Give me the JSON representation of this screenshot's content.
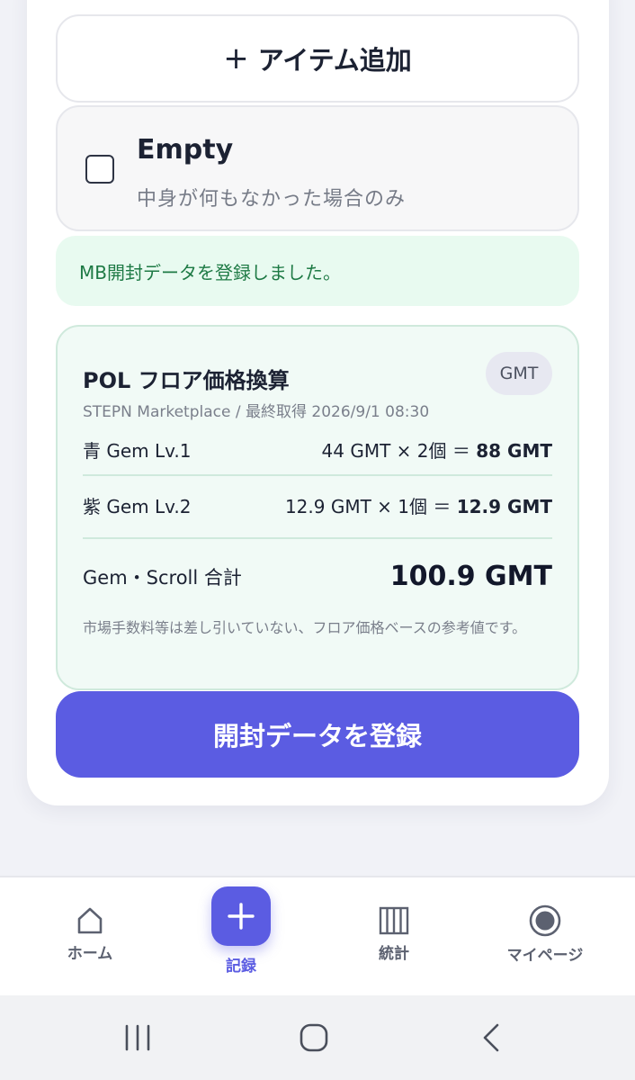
{
  "add_item": {
    "plus": "+",
    "label": "アイテム追加"
  },
  "empty_option": {
    "title": "Empty",
    "subtitle": "中身が何もなかった場合のみ",
    "checked": false
  },
  "toast": {
    "message": "MB開封データを登録しました。"
  },
  "pol_card": {
    "title": "POL フロア価格換算",
    "currency_badge": "GMT",
    "source": "STEPN Marketplace / 最終取得 2026/9/1 08:30",
    "rows": [
      {
        "name": "青 Gem Lv.1",
        "calc": "44 GMT × 2個 ＝",
        "result": "88 GMT"
      },
      {
        "name": "紫 Gem Lv.2",
        "calc": "12.9 GMT × 1個 ＝",
        "result": "12.9 GMT"
      }
    ],
    "total_label": "Gem・Scroll 合計",
    "total_value": "100.9 GMT",
    "note": "市場手数料等は差し引いていない、フロア価格ベースの参考値です。"
  },
  "submit": {
    "label": "開封データを登録"
  },
  "bottom_nav": {
    "home": {
      "label": "ホーム",
      "icon": "home-icon"
    },
    "record": {
      "label": "記録",
      "icon": "plus-icon"
    },
    "stats": {
      "label": "統計",
      "icon": "bar-columns-icon"
    },
    "mypage": {
      "label": "マイページ",
      "icon": "target-circle-icon"
    }
  },
  "colors": {
    "accent": "#5b5ce2",
    "success_bg": "#e8faf0",
    "success_text": "#1e7a45",
    "card_green_bg": "#f1faf6"
  }
}
